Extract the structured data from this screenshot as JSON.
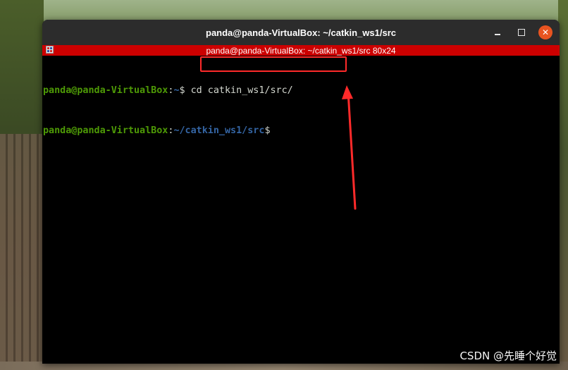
{
  "window": {
    "title": "panda@panda-VirtualBox: ~/catkin_ws1/src",
    "controls": {
      "minimize": "minimize-icon",
      "maximize": "maximize-icon",
      "close": "close-icon"
    }
  },
  "info_bar": {
    "text": "panda@panda-VirtualBox: ~/catkin_ws1/src 80x24"
  },
  "terminal": {
    "lines": [
      {
        "user": "panda@panda-VirtualBox",
        "colon": ":",
        "path": "~",
        "prompt": "$",
        "command": " cd catkin_ws1/src/"
      },
      {
        "user": "panda@panda-VirtualBox",
        "colon": ":",
        "path": "~/catkin_ws1/src",
        "prompt": "$",
        "command": ""
      }
    ]
  },
  "annotation": {
    "color": "#ff2a2a"
  },
  "watermark": "CSDN @先睡个好觉",
  "colors": {
    "user": "#4e9a06",
    "path": "#3465a4",
    "infobar": "#cc0000",
    "titlebar": "#2c2c2c",
    "close": "#e95420"
  }
}
